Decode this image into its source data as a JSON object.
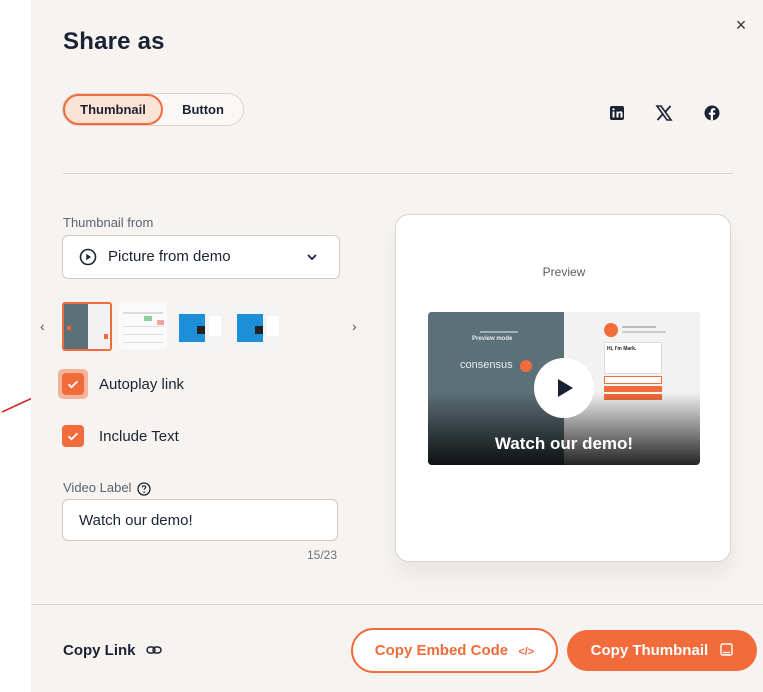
{
  "dialog": {
    "title": "Share as",
    "close_icon": "×"
  },
  "tabs": {
    "thumbnail": "Thumbnail",
    "button": "Button",
    "selected": "Thumbnail"
  },
  "social": [
    "linkedin-icon",
    "x-icon",
    "facebook-icon"
  ],
  "thumbnail_from": {
    "label": "Thumbnail from",
    "value": "Picture from demo"
  },
  "thumbnails": {
    "selected_index": 0,
    "count": 4
  },
  "options": {
    "autoplay_label": "Autoplay link",
    "autoplay_checked": true,
    "include_text_label": "Include Text",
    "include_text_checked": true
  },
  "video_label": {
    "label": "Video Label",
    "value": "Watch our demo!",
    "counter": "15/23"
  },
  "preview": {
    "label": "Preview",
    "caption": "Watch our demo!",
    "brand": "consensus",
    "mode_text": "Preview mode",
    "chat_greeting": "Hi, I'm Mark."
  },
  "footer": {
    "copy_link": "Copy Link",
    "copy_embed": "Copy Embed Code",
    "copy_thumbnail": "Copy Thumbnail"
  },
  "colors": {
    "accent": "#f26b3a",
    "panel": "#f6f3f0",
    "annotation_arrow": "#d62828"
  }
}
